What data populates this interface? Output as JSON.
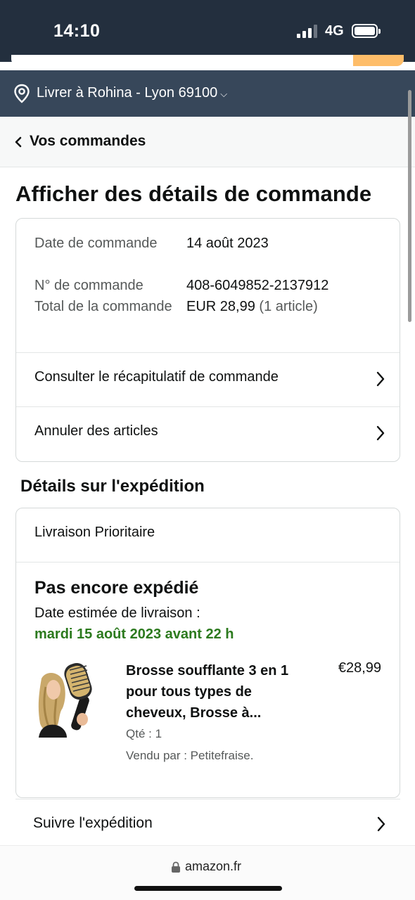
{
  "status_bar": {
    "time": "14:10",
    "network": "4G"
  },
  "delivery": {
    "label": "Livrer à Rohina - Lyon 69100",
    "chevron": "⌵"
  },
  "nav": {
    "back_label": "Vos commandes"
  },
  "page": {
    "title": "Afficher des détails de commande"
  },
  "order_summary": {
    "date_label": "Date de commande",
    "date_value": "14 août 2023",
    "number_label": "N° de commande",
    "number_value": "408-6049852-2137912",
    "total_label": "Total de la commande",
    "total_value": "EUR 28,99",
    "total_count": "(1 article)",
    "links": [
      {
        "label": "Consulter le récapitulatif de commande"
      },
      {
        "label": "Annuler des articles"
      }
    ]
  },
  "shipment": {
    "section_title": "Détails sur l'expédition",
    "method": "Livraison Prioritaire",
    "status": "Pas encore expédié",
    "estimate_label": "Date estimée de livraison :",
    "estimate_date": "mardi 15 août 2023 avant 22 h",
    "estimate_color": "#2c7a1e",
    "item": {
      "title": "Brosse soufflante 3 en 1 pour tous types de cheveux, Brosse à...",
      "price": "€28,99",
      "quantity": "Qté : 1",
      "seller": "Vendu par : Petitefraise.",
      "image_icon": "hair-dryer-brush-product-image"
    },
    "track_label": "Suivre l'expédition"
  },
  "browser": {
    "url": "amazon.fr"
  },
  "colors": {
    "header_dark": "#232f3e",
    "subheader": "#37475a",
    "accent_search": "#febd69"
  }
}
